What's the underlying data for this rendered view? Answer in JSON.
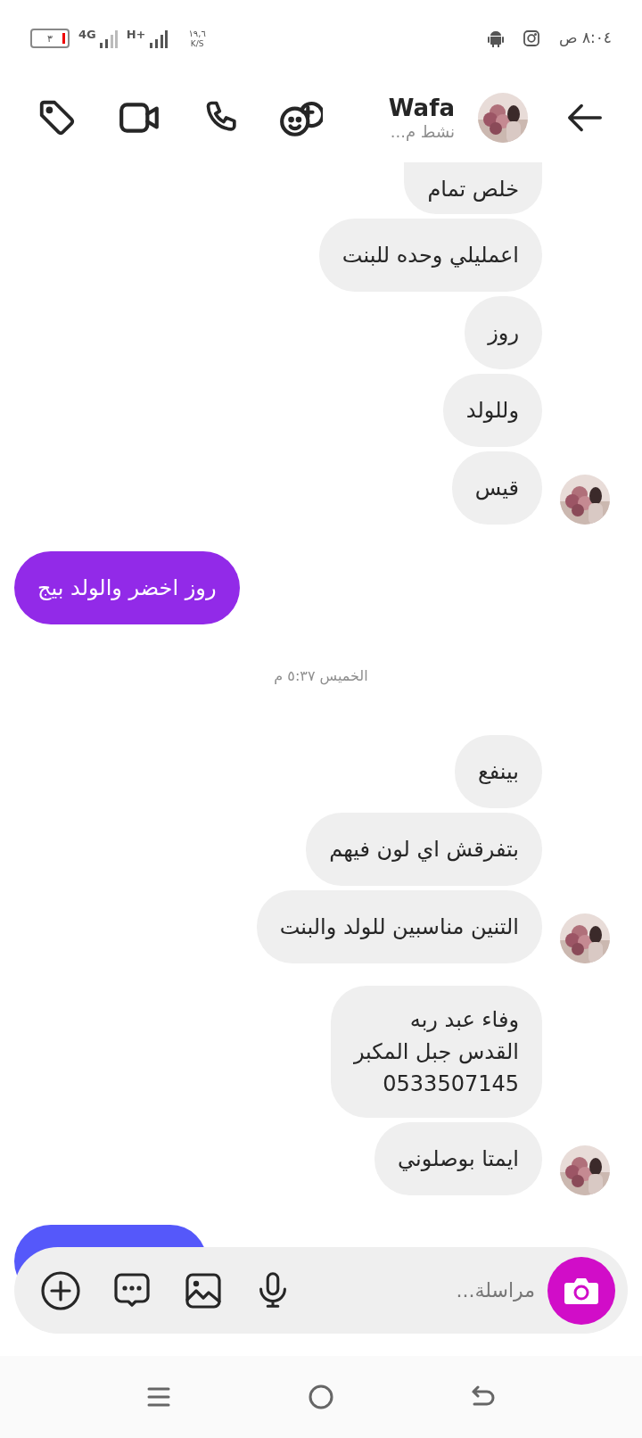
{
  "status_bar": {
    "battery": "٣",
    "network_1": "4G",
    "network_2": "H+",
    "speed": "١٩,٦",
    "speed_unit": "K/S",
    "time": "٨:٠٤ ص"
  },
  "header": {
    "name": "Wafa",
    "status": "نشط م..."
  },
  "messages": [
    {
      "kind": "cut",
      "text": "خلص تمام"
    },
    {
      "kind": "received",
      "text": "اعمليلي وحده للبنت",
      "avatar": false
    },
    {
      "kind": "received",
      "text": "روز",
      "avatar": false
    },
    {
      "kind": "received",
      "text": "وللولد",
      "avatar": false
    },
    {
      "kind": "received",
      "text": "قيس",
      "avatar": true
    },
    {
      "kind": "sent",
      "text": "روز اخضر والولد بيج",
      "color": "#922ae8"
    },
    {
      "kind": "timestamp",
      "text": "الخميس ٥:٣٧ م"
    },
    {
      "kind": "received",
      "text": "بينفع",
      "avatar": false
    },
    {
      "kind": "received",
      "text": "بتفرقش اي لون فيهم",
      "avatar": false
    },
    {
      "kind": "received",
      "text": "التنين مناسبين للولد والبنت",
      "avatar": true
    },
    {
      "kind": "received",
      "text": "وفاء عبد ربه\nالقدس جبل المكبر\n0533507145",
      "avatar": false
    },
    {
      "kind": "received",
      "text": "ايمتا بوصلوني",
      "avatar": true
    },
    {
      "kind": "covered",
      "color": "#5558fa"
    }
  ],
  "composer": {
    "placeholder": "مراسلة..."
  }
}
